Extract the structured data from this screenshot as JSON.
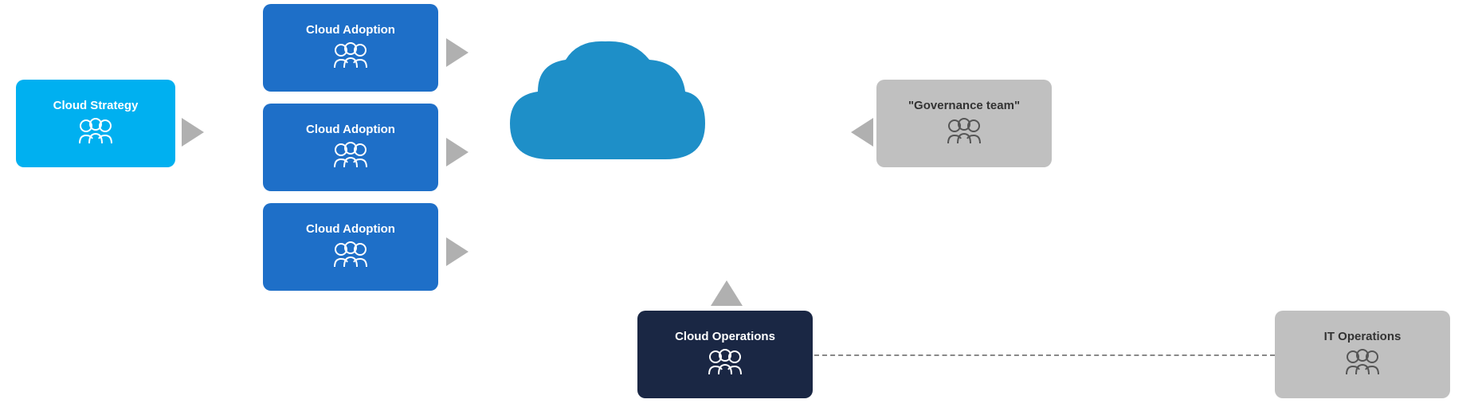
{
  "boxes": {
    "strategy": {
      "label": "Cloud Strategy",
      "icon": "👥"
    },
    "adoption1": {
      "label": "Cloud Adoption",
      "icon": "👥"
    },
    "adoption2": {
      "label": "Cloud Adoption",
      "icon": "👥"
    },
    "adoption3": {
      "label": "Cloud Adoption",
      "icon": "👥"
    },
    "operations": {
      "label": "Cloud Operations",
      "icon": "👥"
    },
    "governance": {
      "label": "\"Governance team\"",
      "icon": "👥"
    },
    "it_operations": {
      "label": "IT Operations",
      "icon": "👥"
    }
  },
  "arrows": {
    "right": "→",
    "left": "←",
    "up": "↑"
  },
  "colors": {
    "strategy_bg": "#00b0f0",
    "adoption_bg": "#1e6fc8",
    "operations_bg": "#1a2744",
    "governance_bg": "#c0c0c0",
    "it_ops_bg": "#c0c0c0",
    "cloud_fill": "#1e8fc8",
    "arrow_fill": "#b0b0b0"
  }
}
